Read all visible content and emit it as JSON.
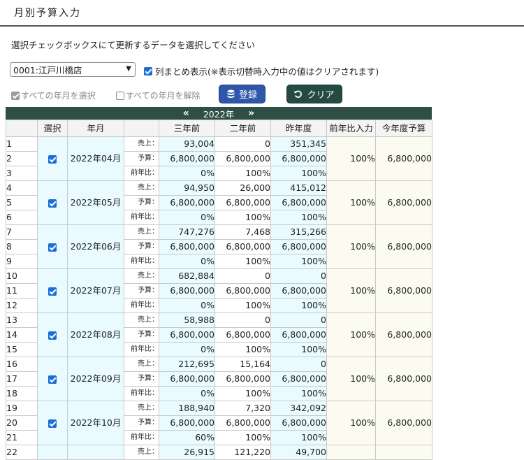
{
  "page_title": "月別予算入力",
  "instruction": "選択チェックボックスにて更新するデータを選択してください",
  "store_select": {
    "value": "0001:江戸川橋店"
  },
  "column_summary": {
    "label": "列まとめ表示(※表示切替時入力中の値はクリアされます)",
    "checked": true
  },
  "select_all_label": "すべての年月を選択",
  "deselect_all_label": "すべての年月を解除",
  "buttons": {
    "register": "登録",
    "clear": "クリア"
  },
  "year_nav": {
    "prev": "«",
    "year": "2022年",
    "next": "»"
  },
  "table": {
    "headers": [
      "選択",
      "年月",
      "三年前",
      "二年前",
      "昨年度",
      "前年比入力",
      "今年度予算"
    ],
    "row_labels": [
      "売上：",
      "予算：",
      "前年比："
    ],
    "groups": [
      {
        "month": "2022年04月",
        "ratio": "100%",
        "budget": "6,800,000",
        "sales": [
          "93,004",
          "0",
          "351,345"
        ],
        "plan": [
          "6,800,000",
          "6,800,000",
          "6,800,000"
        ],
        "yoy": [
          "0%",
          "100%",
          "100%"
        ]
      },
      {
        "month": "2022年05月",
        "ratio": "100%",
        "budget": "6,800,000",
        "sales": [
          "94,950",
          "26,000",
          "415,012"
        ],
        "plan": [
          "6,800,000",
          "6,800,000",
          "6,800,000"
        ],
        "yoy": [
          "0%",
          "100%",
          "100%"
        ]
      },
      {
        "month": "2022年06月",
        "ratio": "100%",
        "budget": "6,800,000",
        "sales": [
          "747,276",
          "7,468",
          "315,266"
        ],
        "plan": [
          "6,800,000",
          "6,800,000",
          "6,800,000"
        ],
        "yoy": [
          "0%",
          "100%",
          "100%"
        ]
      },
      {
        "month": "2022年07月",
        "ratio": "100%",
        "budget": "6,800,000",
        "sales": [
          "682,884",
          "0",
          "0"
        ],
        "plan": [
          "6,800,000",
          "6,800,000",
          "6,800,000"
        ],
        "yoy": [
          "0%",
          "100%",
          "100%"
        ]
      },
      {
        "month": "2022年08月",
        "ratio": "100%",
        "budget": "6,800,000",
        "sales": [
          "58,988",
          "0",
          "0"
        ],
        "plan": [
          "6,800,000",
          "6,800,000",
          "6,800,000"
        ],
        "yoy": [
          "0%",
          "100%",
          "100%"
        ]
      },
      {
        "month": "2022年09月",
        "ratio": "100%",
        "budget": "6,800,000",
        "sales": [
          "212,695",
          "15,164",
          "0"
        ],
        "plan": [
          "6,800,000",
          "6,800,000",
          "6,800,000"
        ],
        "yoy": [
          "0%",
          "100%",
          "100%"
        ]
      },
      {
        "month": "2022年10月",
        "ratio": "100%",
        "budget": "6,800,000",
        "sales": [
          "188,940",
          "7,320",
          "342,092"
        ],
        "plan": [
          "6,800,000",
          "6,800,000",
          "6,800,000"
        ],
        "yoy": [
          "60%",
          "100%",
          "100%"
        ]
      }
    ],
    "partial_row": {
      "number": "22",
      "label": "売上：",
      "sales": [
        "26,915",
        "121,220",
        "49,700"
      ]
    }
  }
}
